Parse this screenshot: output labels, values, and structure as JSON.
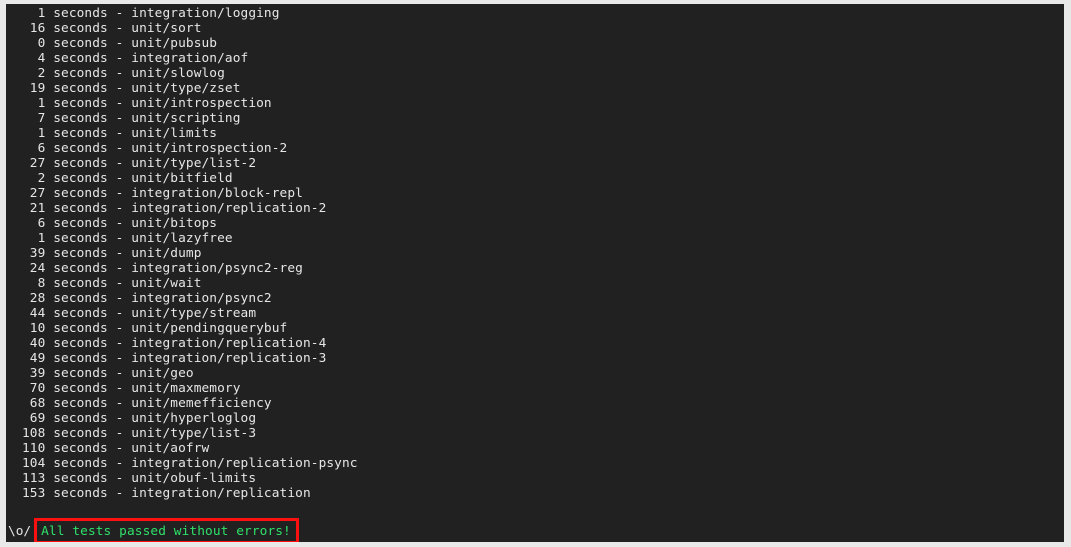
{
  "terminal": {
    "background_color": "#212121",
    "frame_color": "#e9e9e9",
    "text_color": "#e6e6e6",
    "success_color": "#2ee06a",
    "annotation_color": "#fc1010",
    "unit_label": "seconds",
    "separator": "-",
    "log_lines": [
      "  1 seconds - integration/logging",
      " 16 seconds - unit/sort",
      "  0 seconds - unit/pubsub",
      "  4 seconds - integration/aof",
      "  2 seconds - unit/slowlog",
      " 19 seconds - unit/type/zset",
      "  1 seconds - unit/introspection",
      "  7 seconds - unit/scripting",
      "  1 seconds - unit/limits",
      "  6 seconds - unit/introspection-2",
      " 27 seconds - unit/type/list-2",
      "  2 seconds - unit/bitfield",
      " 27 seconds - integration/block-repl",
      " 21 seconds - integration/replication-2",
      "  6 seconds - unit/bitops",
      "  1 seconds - unit/lazyfree",
      " 39 seconds - unit/dump",
      " 24 seconds - integration/psync2-reg",
      "  8 seconds - unit/wait",
      " 28 seconds - integration/psync2",
      " 44 seconds - unit/type/stream",
      " 10 seconds - unit/pendingquerybuf",
      " 40 seconds - integration/replication-4",
      " 49 seconds - integration/replication-3",
      " 39 seconds - unit/geo",
      " 70 seconds - unit/maxmemory",
      " 68 seconds - unit/memefficiency",
      " 69 seconds - unit/hyperloglog",
      "108 seconds - unit/type/list-3",
      "110 seconds - unit/aofrw",
      "104 seconds - integration/replication-psync",
      "113 seconds - unit/obuf-limits",
      "153 seconds - integration/replication"
    ],
    "test_results": [
      {
        "seconds": 1,
        "suite": "integration/logging"
      },
      {
        "seconds": 16,
        "suite": "unit/sort"
      },
      {
        "seconds": 0,
        "suite": "unit/pubsub"
      },
      {
        "seconds": 4,
        "suite": "integration/aof"
      },
      {
        "seconds": 2,
        "suite": "unit/slowlog"
      },
      {
        "seconds": 19,
        "suite": "unit/type/zset"
      },
      {
        "seconds": 1,
        "suite": "unit/introspection"
      },
      {
        "seconds": 7,
        "suite": "unit/scripting"
      },
      {
        "seconds": 1,
        "suite": "unit/limits"
      },
      {
        "seconds": 6,
        "suite": "unit/introspection-2"
      },
      {
        "seconds": 27,
        "suite": "unit/type/list-2"
      },
      {
        "seconds": 2,
        "suite": "unit/bitfield"
      },
      {
        "seconds": 27,
        "suite": "integration/block-repl"
      },
      {
        "seconds": 21,
        "suite": "integration/replication-2"
      },
      {
        "seconds": 6,
        "suite": "unit/bitops"
      },
      {
        "seconds": 1,
        "suite": "unit/lazyfree"
      },
      {
        "seconds": 39,
        "suite": "unit/dump"
      },
      {
        "seconds": 24,
        "suite": "integration/psync2-reg"
      },
      {
        "seconds": 8,
        "suite": "unit/wait"
      },
      {
        "seconds": 28,
        "suite": "integration/psync2"
      },
      {
        "seconds": 44,
        "suite": "unit/type/stream"
      },
      {
        "seconds": 10,
        "suite": "unit/pendingquerybuf"
      },
      {
        "seconds": 40,
        "suite": "integration/replication-4"
      },
      {
        "seconds": 49,
        "suite": "integration/replication-3"
      },
      {
        "seconds": 39,
        "suite": "unit/geo"
      },
      {
        "seconds": 70,
        "suite": "unit/maxmemory"
      },
      {
        "seconds": 68,
        "suite": "unit/memefficiency"
      },
      {
        "seconds": 69,
        "suite": "unit/hyperloglog"
      },
      {
        "seconds": 108,
        "suite": "unit/type/list-3"
      },
      {
        "seconds": 110,
        "suite": "unit/aofrw"
      },
      {
        "seconds": 104,
        "suite": "integration/replication-psync"
      },
      {
        "seconds": 113,
        "suite": "unit/obuf-limits"
      },
      {
        "seconds": 153,
        "suite": "integration/replication"
      }
    ],
    "success": {
      "prefix": "\\o/",
      "message": "All tests passed without errors!"
    }
  }
}
